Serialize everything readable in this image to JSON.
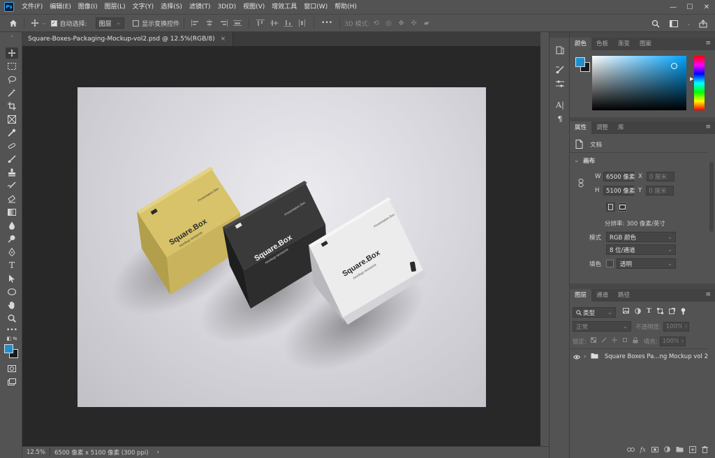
{
  "app": {
    "logo_text": "Ps",
    "menu": [
      "文件(F)",
      "编辑(E)",
      "图像(I)",
      "图层(L)",
      "文字(Y)",
      "选择(S)",
      "滤镜(T)",
      "3D(D)",
      "视图(V)",
      "增效工具",
      "窗口(W)",
      "帮助(H)"
    ],
    "window_controls": [
      "—",
      "☐",
      "✕"
    ]
  },
  "options_bar": {
    "auto_select_label": "自动选择:",
    "auto_select_target": "图层",
    "show_transform_label": "显示变换控件",
    "mode_3d_label": "3D 模式:",
    "more": "•••"
  },
  "document": {
    "tab_title": "Square-Boxes-Packaging-Mockup-vol2.psd @ 12.5%(RGB/8)",
    "close": "×"
  },
  "canvas": {
    "boxes": [
      {
        "name": "yellow",
        "brand": "Square.Box",
        "tagline": "mockup resource",
        "top_label": "Presentation.Box"
      },
      {
        "name": "black",
        "brand": "Square.Box",
        "tagline": "mockup resource",
        "top_label": "Presentation.Box"
      },
      {
        "name": "white",
        "brand": "Square.Box",
        "tagline": "mockup resource",
        "top_label": "Presentation.Box"
      }
    ]
  },
  "status": {
    "zoom": "12.5%",
    "doc_info": "6500 像素 x 5100 像素 (300 ppi)",
    "arrow": "›"
  },
  "color_panel": {
    "tabs": [
      "颜色",
      "色板",
      "渐变",
      "图案"
    ],
    "active_tab": 0,
    "fg_color": "#1e8fcf",
    "bg_color": "#1a1a1a"
  },
  "properties_panel": {
    "tabs": [
      "属性",
      "调整",
      "库"
    ],
    "active_tab": 0,
    "doc_label": "文档",
    "section_title": "画布",
    "w_label": "W",
    "w_value": "6500 像素",
    "h_label": "H",
    "h_value": "5100 像素",
    "x_label": "X",
    "x_value": "0 厘米",
    "y_label": "Y",
    "y_value": "0 厘米",
    "resolution": "分辨率: 300 像素/英寸",
    "mode_label": "模式",
    "mode_value": "RGB 颜色",
    "depth_value": "8 位/通道",
    "fill_label": "填色",
    "fill_value": "透明"
  },
  "layers_panel": {
    "tabs": [
      "图层",
      "通道",
      "路径"
    ],
    "active_tab": 0,
    "filter_label": "类型",
    "blend_mode": "正常",
    "opacity_label": "不透明度:",
    "opacity_value": "100%",
    "lock_label": "锁定:",
    "fill_label": "填充:",
    "fill_value": "100%",
    "layers": [
      {
        "name": "Square Boxes Pa...ng Mockup vol 2",
        "type": "group",
        "visible": true
      }
    ]
  }
}
